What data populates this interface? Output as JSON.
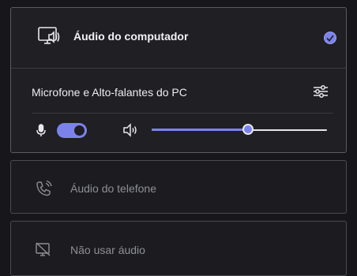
{
  "audio_options": {
    "computer": {
      "title": "Áudio do computador",
      "icon": "computer-audio-icon",
      "selected": true,
      "device_label": "Microfone e Alto-falantes do PC",
      "settings_icon": "device-settings-icon",
      "mic_icon": "microphone-icon",
      "mic_enabled": true,
      "speaker_icon": "speaker-icon",
      "volume_percent": 55
    },
    "phone": {
      "label": "Áudio do telefone",
      "icon": "phone-audio-icon"
    },
    "none": {
      "label": "Não usar áudio",
      "icon": "no-audio-icon"
    }
  },
  "colors": {
    "accent": "#7b83eb",
    "background": "#17171b",
    "card": "#1f1f24",
    "muted_text": "#8e8e98"
  }
}
